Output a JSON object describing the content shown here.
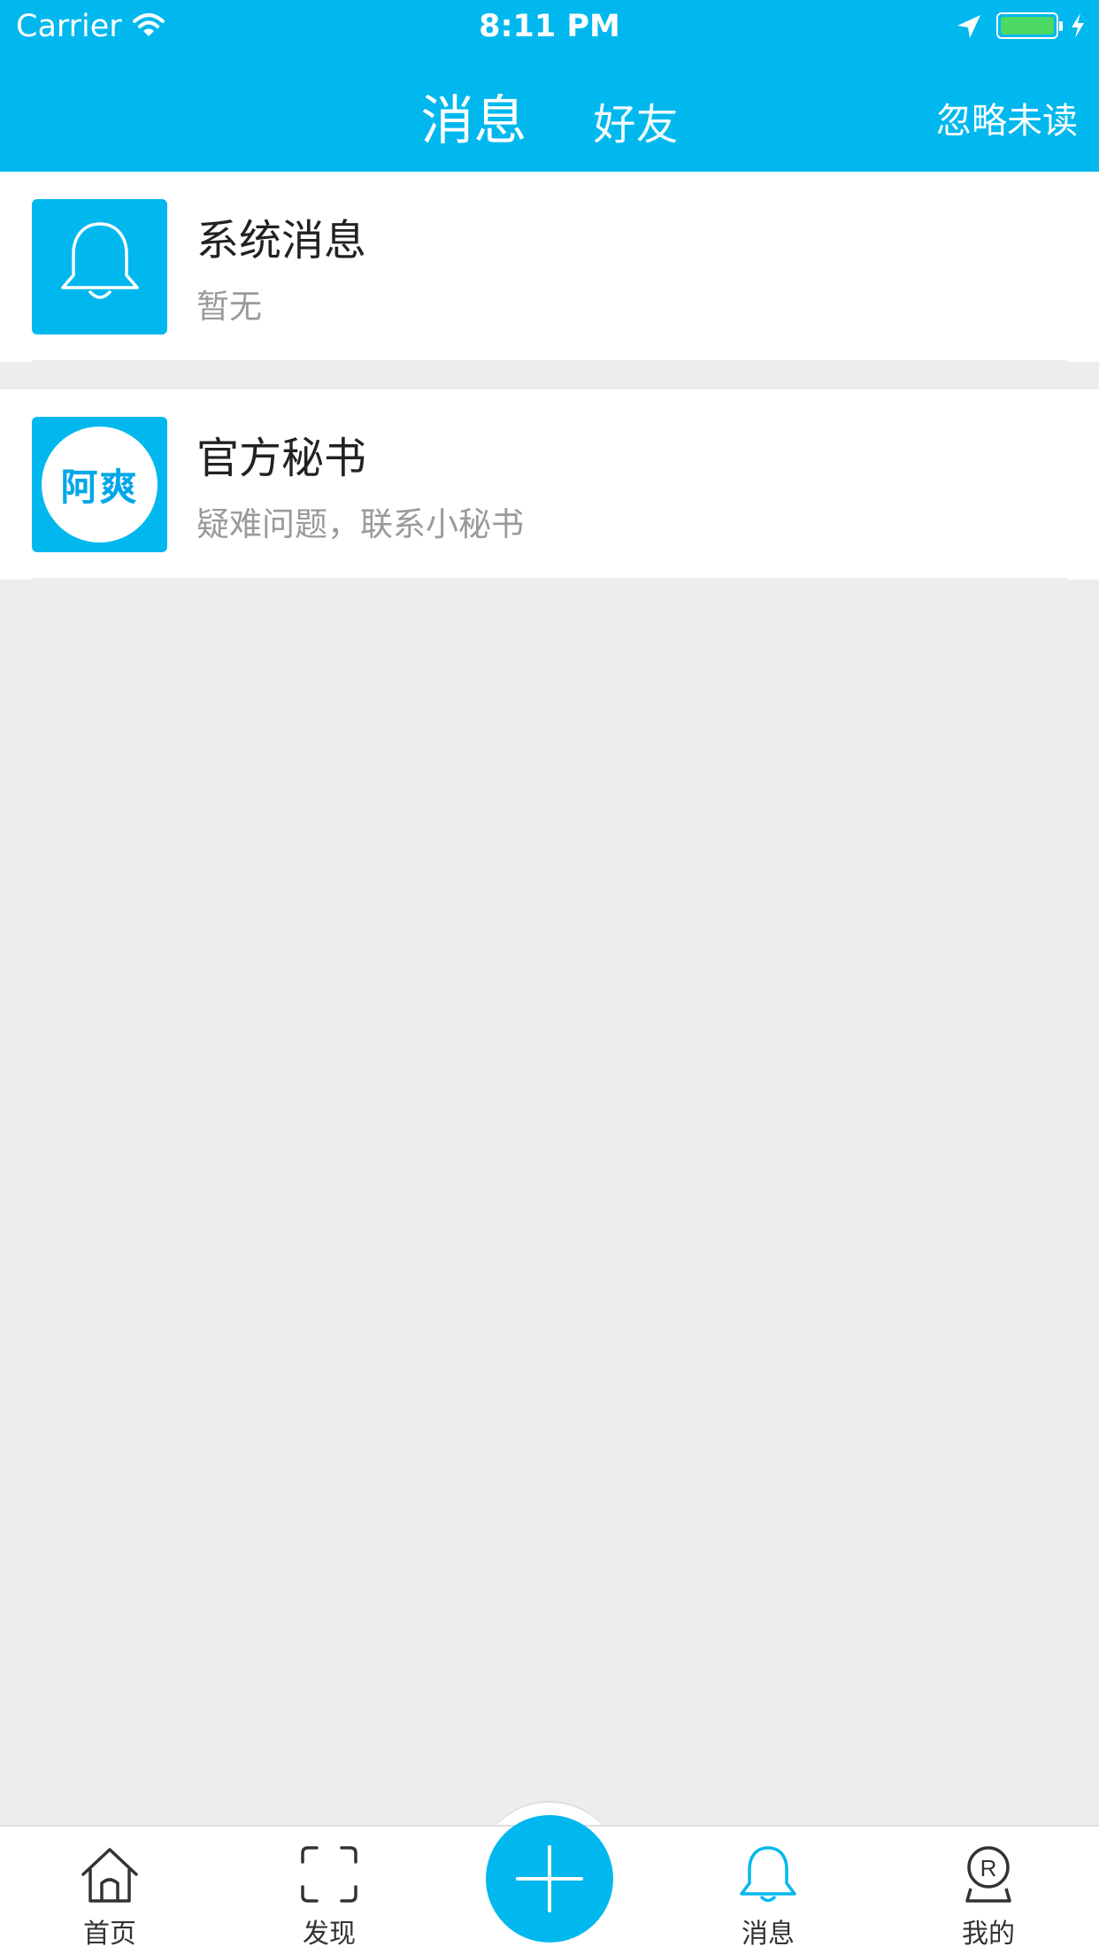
{
  "status_bar": {
    "carrier": "Carrier",
    "time": "8:11 PM"
  },
  "nav": {
    "tabs": [
      {
        "label": "消息",
        "active": true
      },
      {
        "label": "好友",
        "active": false
      }
    ],
    "right_action": "忽略未读"
  },
  "messages": [
    {
      "title": "系统消息",
      "subtitle": "暂无",
      "icon": "bell-icon"
    },
    {
      "title": "官方秘书",
      "subtitle": "疑难问题，联系小秘书",
      "avatar_text": "阿爽"
    }
  ],
  "tabbar": {
    "items": [
      {
        "label": "首页",
        "icon": "home-icon"
      },
      {
        "label": "发现",
        "icon": "scan-icon"
      },
      {
        "label": "",
        "icon": "plus-icon"
      },
      {
        "label": "消息",
        "icon": "bell-icon",
        "active": true
      },
      {
        "label": "我的",
        "icon": "profile-icon"
      }
    ]
  },
  "colors": {
    "accent": "#00b8ee",
    "background": "#ededed",
    "battery": "#4cd964"
  }
}
